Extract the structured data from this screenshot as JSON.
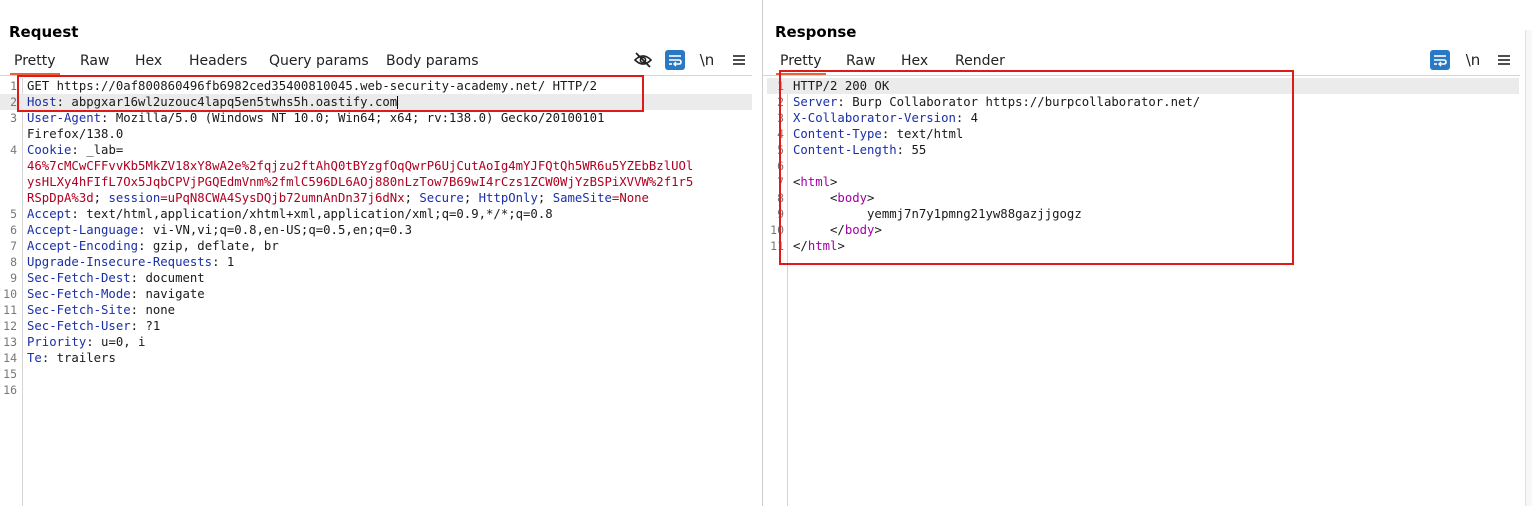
{
  "request": {
    "title": "Request",
    "tabs": [
      "Pretty",
      "Raw",
      "Hex",
      "Headers",
      "Query params",
      "Body params"
    ],
    "active_tab": "Pretty",
    "toolbar_icons": [
      "eye-slash-icon",
      "word-wrap-icon",
      "newline-icon",
      "menu-icon"
    ],
    "newline_label": "\\n",
    "line_numbers": [
      "1",
      "2",
      "3",
      "",
      "4",
      "",
      "",
      "",
      "5",
      "6",
      "7",
      "8",
      "9",
      "10",
      "11",
      "12",
      "13",
      "14",
      "15",
      "16"
    ],
    "lines": {
      "l1": "GET https://0af800860496fb6982ced35400810045.web-security-academy.net/ HTTP/2",
      "l2_key": "Host",
      "l2_val": ": abpgxar16wl2uzouc4lapq5en5twhs5h.oastify.com",
      "l3_key": "User-Agent",
      "l3_val": ": Mozilla/5.0 (Windows NT 10.0; Win64; x64; rv:138.0) Gecko/20100101",
      "l3b": "Firefox/138.0",
      "l4_key": "Cookie",
      "l4_val": ": _lab=",
      "l4b": "46%7cMCwCFFvvKb5MkZV18xY8wA2e%2fqjzu2ftAhQ0tBYzgfOqQwrP6UjCutAoIg4mYJFQtQh5WR6u5YZEbBzlUOl",
      "l4c": "ysHLXy4hFIfL7Ox5JqbCPVjPGQEdmVnm%2fmlC596DL6AOj880nLzTow7B69wI4rCzs1ZCW0WjYzBSPiXVVW%2f1r5",
      "l4d_val1": "RSpDpA%3d",
      "l4d_key2": "session",
      "l4d_val2": "=uPqN8CWA4SysDQjb72umnAnDn37j6dNx",
      "l4d_flag1": "Secure",
      "l4d_flag2": "HttpOnly",
      "l4d_key3": "SameSite",
      "l4d_val3": "=None",
      "l5_key": "Accept",
      "l5_val": ": text/html,application/xhtml+xml,application/xml;q=0.9,*/*;q=0.8",
      "l6_key": "Accept-Language",
      "l6_val": ": vi-VN,vi;q=0.8,en-US;q=0.5,en;q=0.3",
      "l7_key": "Accept-Encoding",
      "l7_val": ": gzip, deflate, br",
      "l8_key": "Upgrade-Insecure-Requests",
      "l8_val": ": 1",
      "l9_key": "Sec-Fetch-Dest",
      "l9_val": ": document",
      "l10_key": "Sec-Fetch-Mode",
      "l10_val": ": navigate",
      "l11_key": "Sec-Fetch-Site",
      "l11_val": ": none",
      "l12_key": "Sec-Fetch-User",
      "l12_val": ": ?1",
      "l13_key": "Priority",
      "l13_val": ": u=0, i",
      "l14_key": "Te",
      "l14_val": ": trailers"
    }
  },
  "response": {
    "title": "Response",
    "tabs": [
      "Pretty",
      "Raw",
      "Hex",
      "Render"
    ],
    "active_tab": "Pretty",
    "toolbar_icons": [
      "word-wrap-icon",
      "newline-icon",
      "menu-icon"
    ],
    "newline_label": "\\n",
    "line_numbers": [
      "1",
      "2",
      "3",
      "4",
      "5",
      "6",
      "7",
      "8",
      "9",
      "10",
      "11"
    ],
    "lines": {
      "l1": "HTTP/2 200 OK",
      "l2_key": "Server",
      "l2_val": ": Burp Collaborator https://burpcollaborator.net/",
      "l3_key": "X-Collaborator-Version",
      "l3_val": ": 4",
      "l4_key": "Content-Type",
      "l4_val": ": text/html",
      "l5_key": "Content-Length",
      "l5_val": ": 55",
      "l7_open": "<",
      "l7_tag": "html",
      "l7_close": ">",
      "l8_indent": "     <",
      "l8_tag": "body",
      "l8_close": ">",
      "l9": "          yemmj7n7y1pmng21yw88gazjjgogz",
      "l10_indent": "     </",
      "l10_tag": "body",
      "l10_close": ">",
      "l11_open": "</",
      "l11_tag": "html",
      "l11_close": ">"
    }
  },
  "layout_buttons": [
    "split-horizontal-icon",
    "split-vertical-icon",
    "single-pane-icon"
  ],
  "colors": {
    "accent": "#2a79c5",
    "highlight_box": "#e01919",
    "active_tab_underline": "#e8603c",
    "header_key": "#1a2fa8",
    "cookie_value": "#b00020",
    "html_tag": "#a400a4"
  }
}
